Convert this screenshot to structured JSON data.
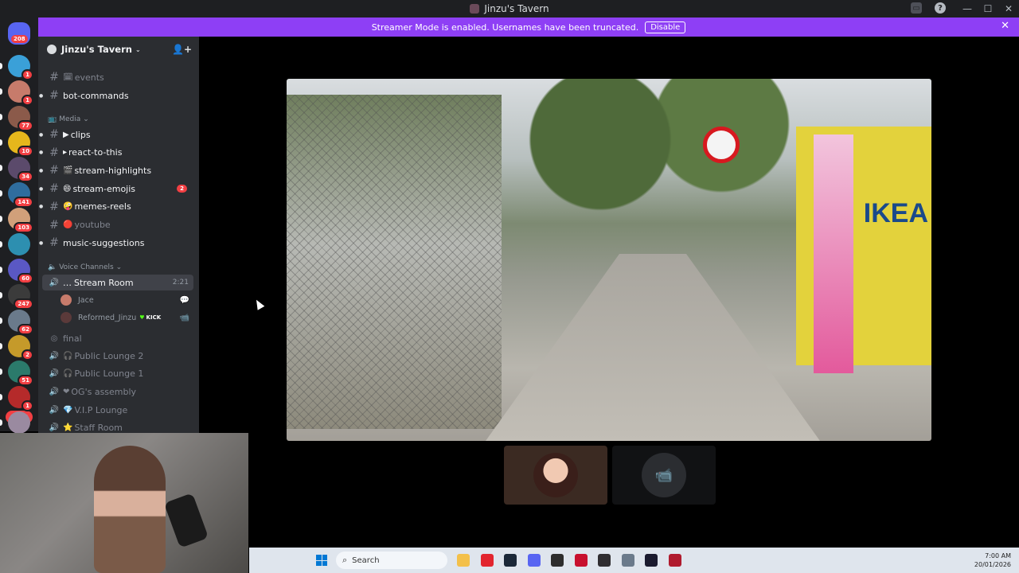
{
  "window": {
    "title": "Jinzu's Tavern",
    "controls": {
      "minimize": "—",
      "maximize": "☐",
      "close": "✕"
    }
  },
  "banner": {
    "text": "Streamer Mode is enabled. Usernames have been truncated.",
    "button": "Disable",
    "close": "✕"
  },
  "guild_list": {
    "top_badge": "208",
    "new_badge": "NEW",
    "guilds": [
      {
        "badge": "1",
        "color": "#3aa0d8"
      },
      {
        "badge": "1",
        "color": "#c77b6b"
      },
      {
        "badge": "77",
        "color": "#8b5a4a"
      },
      {
        "badge": "10",
        "color": "#e6b71c"
      },
      {
        "badge": "34",
        "color": "#5b4a6b"
      },
      {
        "badge": "141",
        "color": "#2f6d9e"
      },
      {
        "badge": "103",
        "color": "#d1a07a"
      },
      {
        "badge": "",
        "color": "#2d8fb0"
      },
      {
        "badge": "60",
        "color": "#5a58c4"
      },
      {
        "badge": "247",
        "color": "#3b3b3b"
      },
      {
        "badge": "62",
        "color": "#6a7a8b"
      },
      {
        "badge": "2",
        "color": "#c59a2a"
      },
      {
        "badge": "51",
        "color": "#2b7a6b"
      },
      {
        "badge": "1",
        "color": "#b52a2a"
      },
      {
        "badge": "",
        "color": "#9a8aa0"
      }
    ]
  },
  "server": {
    "name": "Jinzu's Tavern",
    "chevron": "⌄",
    "channels_top": [
      {
        "name": "events",
        "emoji": "🗓",
        "unread": false
      },
      {
        "name": "bot-commands",
        "emoji": "",
        "unread": true
      }
    ],
    "media_category": "Media",
    "media_channels": [
      {
        "name": "clips",
        "emoji": "▶",
        "unread": true,
        "count": ""
      },
      {
        "name": "react-to-this",
        "emoji": "▸",
        "unread": true,
        "count": ""
      },
      {
        "name": "stream-highlights",
        "emoji": "🎬",
        "unread": true,
        "count": ""
      },
      {
        "name": "stream-emojis",
        "emoji": "😄",
        "unread": true,
        "count": "2"
      },
      {
        "name": "memes-reels",
        "emoji": "🤪",
        "unread": true,
        "count": ""
      },
      {
        "name": "youtube",
        "emoji": "🔴",
        "unread": false,
        "count": ""
      },
      {
        "name": "music-suggestions",
        "emoji": "",
        "unread": true,
        "count": ""
      }
    ],
    "voice_category": "Voice Channels",
    "active_voice": {
      "name": "Stream Room",
      "prefix": "…",
      "timer": "2:21"
    },
    "voice_users": [
      {
        "name": "Jace",
        "color": "#c77b6b",
        "icon": "💬"
      },
      {
        "name": "Reformed_Jinzu",
        "color": "#5b3a3a",
        "kick": "KICK",
        "icon": "📹"
      }
    ],
    "stage_channel": "final",
    "voice_channels": [
      {
        "name": "Public Lounge 2",
        "emoji": "🎧"
      },
      {
        "name": "Public Lounge 1",
        "emoji": "🎧"
      },
      {
        "name": "OG's assembly",
        "emoji": "❤"
      },
      {
        "name": "V.I.P Lounge",
        "emoji": "💎"
      },
      {
        "name": "Staff Room",
        "emoji": "⭐"
      }
    ]
  },
  "stream": {
    "truck_text": "IKEA",
    "participants": [
      {
        "name": "avatar-tile"
      },
      {
        "name": "camera-tile",
        "icon": "📹"
      }
    ]
  },
  "taskbar": {
    "search_placeholder": "Search",
    "time": "7:00 AM",
    "date": "20/01/2026",
    "apps": [
      {
        "name": "file-explorer",
        "color": "#f3c04a"
      },
      {
        "name": "opera",
        "color": "#e2252e"
      },
      {
        "name": "steam",
        "color": "#1b2838"
      },
      {
        "name": "discord",
        "color": "#5865f2"
      },
      {
        "name": "terminal",
        "color": "#2d2d2d"
      },
      {
        "name": "game-app",
        "color": "#c8102e"
      },
      {
        "name": "obs",
        "color": "#302e31"
      },
      {
        "name": "settings",
        "color": "#6b7a8b"
      },
      {
        "name": "media-app",
        "color": "#1a1a2e"
      },
      {
        "name": "red-app",
        "color": "#b01b2e"
      }
    ]
  }
}
